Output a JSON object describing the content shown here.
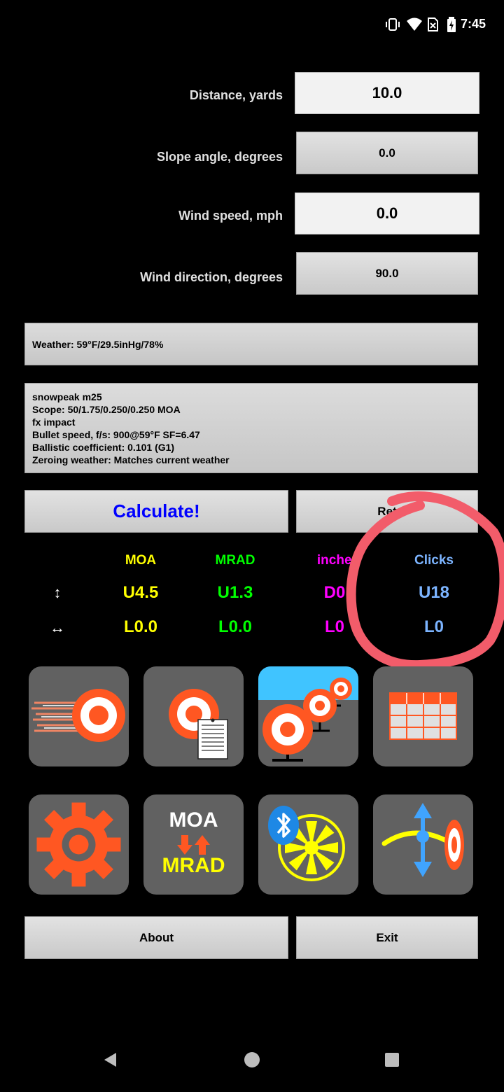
{
  "status": {
    "time": "7:45"
  },
  "inputs": [
    {
      "label": "Distance, yards",
      "value": "10.0"
    },
    {
      "label": "Slope angle, degrees",
      "value": "0.0"
    },
    {
      "label": "Wind speed, mph",
      "value": "0.0"
    },
    {
      "label": "Wind direction, degrees",
      "value": "90.0"
    }
  ],
  "weather": "Weather: 59°F/29.5inHg/78%",
  "profile": [
    "snowpeak m25",
    "Scope: 50/1.75/0.250/0.250 MOA",
    "fx impact",
    "Bullet speed, f/s: 900@59°F SF=6.47",
    "Ballistic coefficient: 0.101 (G1)",
    "Zeroing weather: Matches current weather"
  ],
  "buttons": {
    "calculate": "Calculate!",
    "retrieve": "Ret",
    "about": "About",
    "exit": "Exit"
  },
  "results": {
    "headers": {
      "moa": "MOA",
      "mrad": "MRAD",
      "inches": "inches",
      "clicks": "Clicks"
    },
    "vertical_symbol": "↕",
    "horizontal_symbol": "↔",
    "vertical": {
      "moa": "U4.5",
      "mrad": "U1.3",
      "inches": "D0",
      "clicks": "U18"
    },
    "horizontal": {
      "moa": "L0.0",
      "mrad": "L0.0",
      "inches": "L0",
      "clicks": "L0"
    }
  },
  "tiles": {
    "convert_top": "MOA",
    "convert_bottom": "MRAD"
  },
  "colors": {
    "moa": "#ffff00",
    "mrad": "#00ff00",
    "inches": "#ff00ff",
    "clicks": "#7cb4ff",
    "calculate": "#0000ff",
    "accent": "#ff5722",
    "annotation": "#f25c6a"
  }
}
